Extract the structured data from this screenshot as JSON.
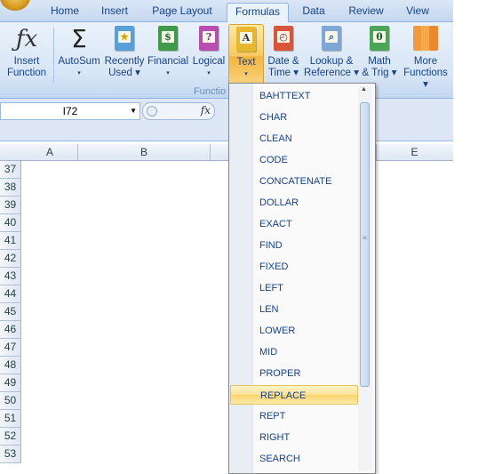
{
  "tabs": [
    "Home",
    "Insert",
    "Page Layout",
    "Formulas",
    "Data",
    "Review",
    "View"
  ],
  "active_tab": "Formulas",
  "ribbon": {
    "buttons": [
      {
        "line1": "Insert",
        "line2": "Function",
        "icon": "fx-icon"
      },
      {
        "line1": "AutoSum",
        "line2": "▾",
        "icon": "sigma-icon"
      },
      {
        "line1": "Recently",
        "line2": "Used ▾",
        "icon": "book-star-icon"
      },
      {
        "line1": "Financial",
        "line2": "▾",
        "icon": "book-money-icon"
      },
      {
        "line1": "Logical",
        "line2": "▾",
        "icon": "book-question-icon"
      },
      {
        "line1": "Text",
        "line2": "▾",
        "icon": "book-text-icon"
      },
      {
        "line1": "Date &",
        "line2": "Time ▾",
        "icon": "book-clock-icon"
      },
      {
        "line1": "Lookup &",
        "line2": "Reference ▾",
        "icon": "book-search-icon"
      },
      {
        "line1": "Math",
        "line2": "& Trig ▾",
        "icon": "book-theta-icon"
      },
      {
        "line1": "More",
        "line2": "Functions ▾",
        "icon": "books-icon"
      }
    ],
    "group_label": "Functio"
  },
  "formula_bar": {
    "name_box": "I72",
    "fx_label": "fx"
  },
  "columns": [
    "A",
    "B",
    "E"
  ],
  "rows": [
    "37",
    "38",
    "39",
    "40",
    "41",
    "42",
    "43",
    "44",
    "45",
    "46",
    "47",
    "48",
    "49",
    "50",
    "51",
    "52",
    "53"
  ],
  "menu": {
    "items": [
      "BAHTTEXT",
      "CHAR",
      "CLEAN",
      "CODE",
      "CONCATENATE",
      "DOLLAR",
      "EXACT",
      "FIND",
      "FIXED",
      "LEFT",
      "LEN",
      "LOWER",
      "MID",
      "PROPER",
      "REPLACE",
      "REPT",
      "RIGHT",
      "SEARCH"
    ],
    "highlighted": "REPLACE"
  }
}
